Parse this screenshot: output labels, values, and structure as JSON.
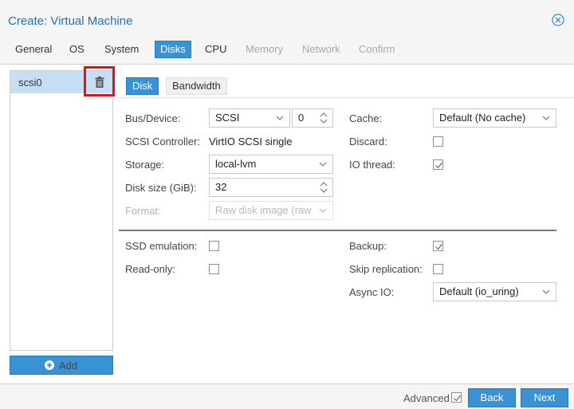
{
  "window": {
    "title": "Create: Virtual Machine"
  },
  "tabs": [
    {
      "label": "General",
      "state": "normal"
    },
    {
      "label": "OS",
      "state": "normal"
    },
    {
      "label": "System",
      "state": "normal"
    },
    {
      "label": "Disks",
      "state": "active"
    },
    {
      "label": "CPU",
      "state": "normal"
    },
    {
      "label": "Memory",
      "state": "disabled"
    },
    {
      "label": "Network",
      "state": "disabled"
    },
    {
      "label": "Confirm",
      "state": "disabled"
    }
  ],
  "disk_list": {
    "items": [
      {
        "label": "scsi0"
      }
    ],
    "add_label": "Add"
  },
  "subtabs": {
    "disk": "Disk",
    "bandwidth": "Bandwidth"
  },
  "fields": {
    "bus_device": {
      "label": "Bus/Device:",
      "bus": "SCSI",
      "device": "0"
    },
    "scsi_controller": {
      "label": "SCSI Controller:",
      "value": "VirtIO SCSI single"
    },
    "storage": {
      "label": "Storage:",
      "value": "local-lvm"
    },
    "disk_size": {
      "label": "Disk size (GiB):",
      "value": "32"
    },
    "format": {
      "label": "Format:",
      "value": "Raw disk image (raw"
    },
    "cache": {
      "label": "Cache:",
      "value": "Default (No cache)"
    },
    "discard": {
      "label": "Discard:",
      "checked": false
    },
    "io_thread": {
      "label": "IO thread:",
      "checked": true
    },
    "ssd_emulation": {
      "label": "SSD emulation:",
      "checked": false
    },
    "read_only": {
      "label": "Read-only:",
      "checked": false
    },
    "backup": {
      "label": "Backup:",
      "checked": true
    },
    "skip_replication": {
      "label": "Skip replication:",
      "checked": false
    },
    "async_io": {
      "label": "Async IO:",
      "value": "Default (io_uring)"
    }
  },
  "footer": {
    "advanced_label": "Advanced",
    "advanced_checked": true,
    "back_label": "Back",
    "next_label": "Next"
  },
  "colors": {
    "accent": "#3892d4",
    "title": "#2a6fb0",
    "highlight": "#e0121b"
  }
}
